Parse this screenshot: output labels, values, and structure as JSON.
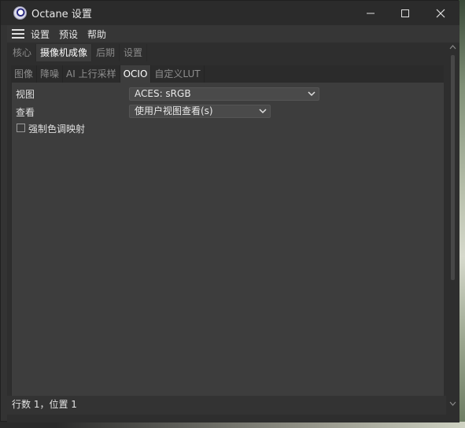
{
  "window": {
    "title": "Octane 设置"
  },
  "menubar": {
    "items": [
      "设置",
      "预设",
      "帮助"
    ]
  },
  "main_tabs": {
    "items": [
      "核心",
      "摄像机成像",
      "后期",
      "设置"
    ],
    "active_index": 1
  },
  "sub_tabs": {
    "items": [
      "图像",
      "降噪",
      "AI 上行采样",
      "OCIO",
      "自定义LUT"
    ],
    "active_index": 3
  },
  "ocio": {
    "view_label": "视图",
    "view_value": "ACES: sRGB",
    "look_label": "查看",
    "look_value": "使用户视图查看(s)",
    "force_tone_label": "强制色调映射",
    "force_tone_checked": false
  },
  "status": {
    "text": "行数 1，位置 1"
  },
  "colors": {
    "window_bg": "#333333",
    "panel_bg": "#3d3d3d",
    "title_bg": "#2b2b2b",
    "active_tab": "#3d3d3d"
  }
}
